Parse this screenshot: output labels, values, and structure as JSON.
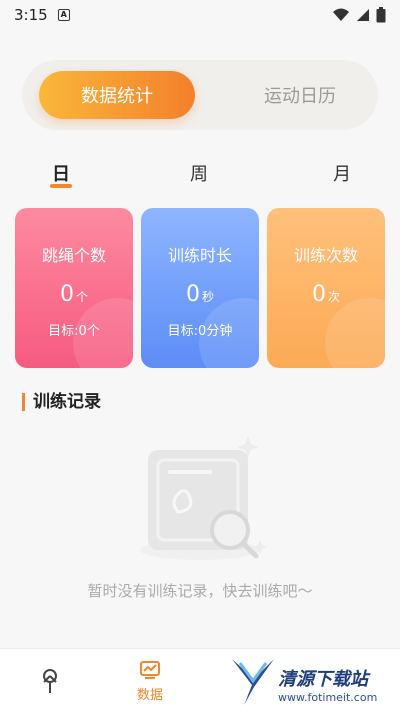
{
  "status_bar": {
    "time": "3:15",
    "notification_glyph": "A"
  },
  "segment": {
    "active": "数据统计",
    "inactive": "运动日历"
  },
  "periods": [
    {
      "label": "日",
      "active": true
    },
    {
      "label": "周",
      "active": false
    },
    {
      "label": "月",
      "active": false
    }
  ],
  "cards": [
    {
      "title": "跳绳个数",
      "value": "0",
      "unit": "个",
      "goal": "目标:0个"
    },
    {
      "title": "训练时长",
      "value": "0",
      "unit": "秒",
      "goal": "目标:0分钟"
    },
    {
      "title": "训练次数",
      "value": "0",
      "unit": "次",
      "goal": ""
    }
  ],
  "section": {
    "title": "训练记录"
  },
  "empty": {
    "text": "暂时没有训练记录，快去训练吧～"
  },
  "tabbar": {
    "active_label": "数据"
  },
  "watermark": {
    "name": "清源下载站",
    "url": "www.fotimeit.com"
  },
  "colors": {
    "accent": "#f4862c",
    "pink": "#f65a80",
    "blue": "#5c8df6",
    "orange": "#fcaa55"
  },
  "icons": [
    "wifi-icon",
    "battery-icon",
    "cellular-icon",
    "training-tab-icon",
    "data-tab-icon",
    "empty-record-icon",
    "magnifier-icon"
  ]
}
